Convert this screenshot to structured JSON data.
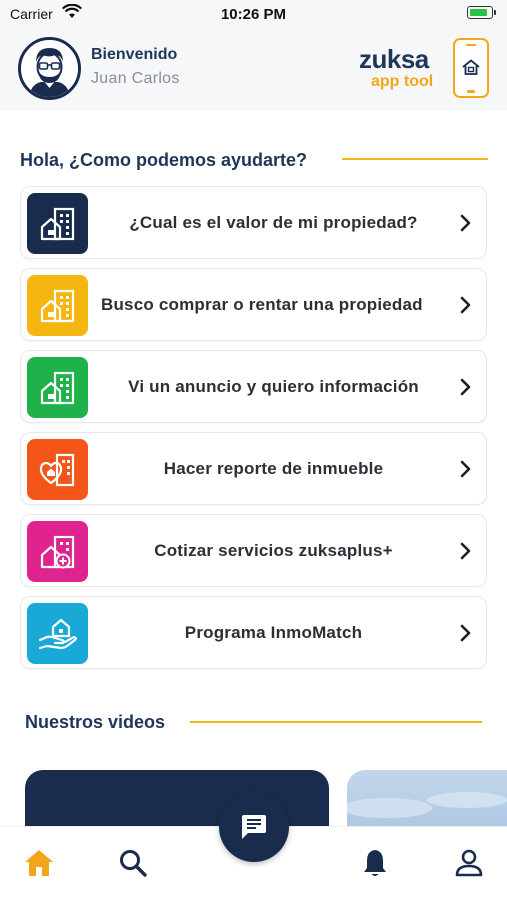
{
  "status_bar": {
    "carrier": "Carrier",
    "time": "10:26 PM"
  },
  "header": {
    "greeting": "Bienvenido",
    "user_name": "Juan Carlos",
    "logo": {
      "brand": "zuksa",
      "subtitle": "app tool"
    }
  },
  "help": {
    "title": "Hola, ¿Como podemos ayudarte?",
    "items": [
      {
        "label": "¿Cual es el valor de mi propiedad?",
        "color": "#1a2c4d",
        "icon": "building-icon"
      },
      {
        "label": "Busco comprar o rentar una propiedad",
        "color": "#f5b70f",
        "icon": "building-icon"
      },
      {
        "label": "Vi un anuncio y quiero información",
        "color": "#1fb24a",
        "icon": "building-icon"
      },
      {
        "label": "Hacer reporte de inmueble",
        "color": "#f4561a",
        "icon": "building-heart-icon"
      },
      {
        "label": "Cotizar servicios zuksaplus+",
        "color": "#e0248f",
        "icon": "building-plus-icon"
      },
      {
        "label": "Programa InmoMatch",
        "color": "#1aa9d6",
        "icon": "hand-house-icon"
      }
    ]
  },
  "videos": {
    "title": "Nuestros videos"
  },
  "tabbar": {
    "accent": "#f4a51c",
    "items": [
      "home-icon",
      "search-icon",
      "chat-icon",
      "bell-icon",
      "user-icon"
    ]
  }
}
